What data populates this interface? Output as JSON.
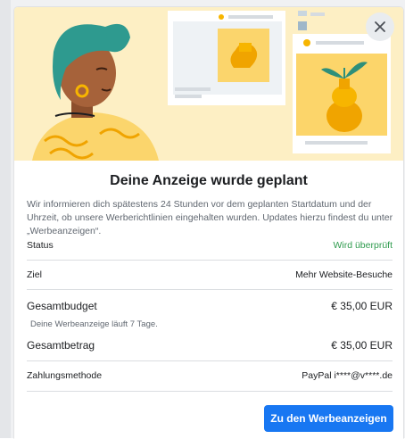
{
  "modal": {
    "title": "Deine Anzeige wurde geplant",
    "description": "Wir informieren dich spätestens 24 Stunden vor dem geplanten Startdatum und der Uhrzeit, ob unsere Werberichtlinien eingehalten wurden. Updates hierzu findest du unter „Werbeanzeigen“.",
    "rows": [
      {
        "label": "Status",
        "value": "Wird überprüft"
      },
      {
        "label": "Ziel",
        "value": "Mehr Website-Besuche"
      },
      {
        "label": "Gesamtbudget",
        "value": "€ 35,00 EUR"
      },
      {
        "label": "Gesamtbetrag",
        "value": "€ 35,00 EUR"
      },
      {
        "label": "Zahlungsmethode",
        "value": "PayPal i****@v****.de"
      }
    ],
    "budget_note": "Deine Werbeanzeige läuft 7 Tage.",
    "primary_button": "Zu den Werbeanzeigen",
    "close_icon": "close-icon"
  },
  "colors": {
    "accent": "#1877f2",
    "status_ok": "#2e9b4d",
    "hero_background": "#fdefc4"
  }
}
